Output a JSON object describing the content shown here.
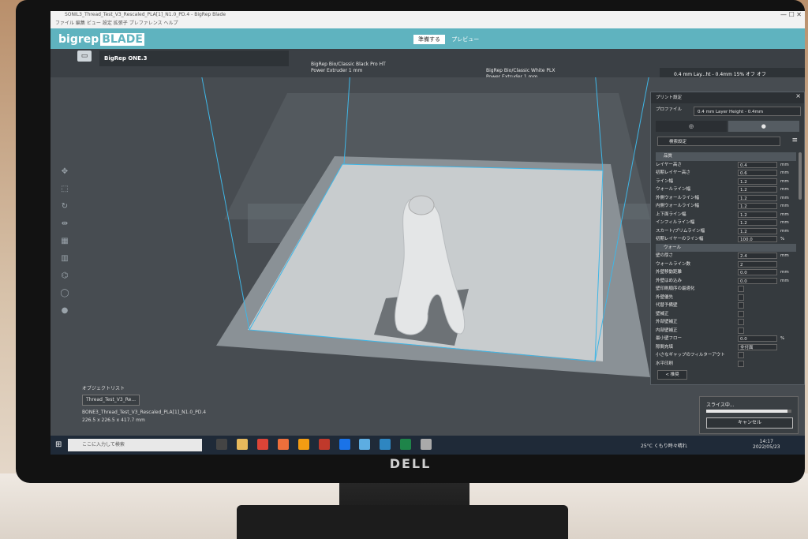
{
  "window": {
    "title": "SONIL3_Thread_Test_V3_Rescaled_PLA[1]_N1.0_PD.4 - BigRep Blade",
    "menu": [
      "ファイル",
      "編集",
      "ビュー",
      "設定",
      "拡張子",
      "プレファレンス",
      "ヘルプ"
    ],
    "controls": "— ☐ ✕"
  },
  "brand": {
    "logo": "bigrep",
    "logo_badge": "BLADE"
  },
  "stage_tabs": {
    "prepare": "準備する",
    "preview": "プレビュー"
  },
  "header": {
    "folder_icon": "folder-icon",
    "printer": "BigRep ONE.3",
    "extruder1": {
      "material": "BigRep Bio/Classic Black Pro HT",
      "extruder": "Power Extruder 1 mm"
    },
    "extruder2": {
      "material": "BigRep Bio/Classic White PLX",
      "extruder": "Power Extruder 1 mm"
    },
    "profile_summary": "0.4 mm Lay...ht - 0.4mm",
    "infill": "15%",
    "support": "オフ",
    "adhesion": "オフ"
  },
  "settings": {
    "title": "プリント設定",
    "profile_label": "プロファイル",
    "profile_value": "0.4 mm Layer Height - 0.4mm",
    "search_placeholder": "検索設定",
    "rows": [
      {
        "label": "品質",
        "type": "category"
      },
      {
        "label": "レイヤー高さ",
        "value": "0.4",
        "unit": "mm"
      },
      {
        "label": "初期レイヤー高さ",
        "value": "0.6",
        "unit": "mm"
      },
      {
        "label": "ライン幅",
        "value": "1.2",
        "unit": "mm"
      },
      {
        "label": "ウォールライン幅",
        "value": "1.2",
        "unit": "mm"
      },
      {
        "label": "外側ウォールライン幅",
        "value": "1.2",
        "unit": "mm"
      },
      {
        "label": "内側ウォールライン幅",
        "value": "1.2",
        "unit": "mm"
      },
      {
        "label": "上下面ライン幅",
        "value": "1.2",
        "unit": "mm"
      },
      {
        "label": "インフィルライン幅",
        "value": "1.2",
        "unit": "mm"
      },
      {
        "label": "スカート/ブリムライン幅",
        "value": "1.2",
        "unit": "mm"
      },
      {
        "label": "初期レイヤーのライン幅",
        "value": "100.0",
        "unit": "%"
      },
      {
        "label": "ウォール",
        "type": "category"
      },
      {
        "label": "壁の厚さ",
        "value": "2.4",
        "unit": "mm"
      },
      {
        "label": "ウォールライン数",
        "value": "2",
        "unit": ""
      },
      {
        "label": "外壁移動距離",
        "value": "0.0",
        "unit": "mm"
      },
      {
        "label": "外壁はめ込み",
        "value": "0.0",
        "unit": "mm"
      },
      {
        "label": "壁印刷順序の最適化",
        "type": "check"
      },
      {
        "label": "外壁優先",
        "type": "check"
      },
      {
        "label": "代替予備壁",
        "type": "check"
      },
      {
        "label": "壁補正",
        "type": "check"
      },
      {
        "label": "外部壁補正",
        "type": "check"
      },
      {
        "label": "内部壁補正",
        "type": "check"
      },
      {
        "label": "最小壁フロー",
        "value": "0.0",
        "unit": "%"
      },
      {
        "label": "隙間充填",
        "value": "全付面",
        "unit": ""
      },
      {
        "label": "小さなギャップのフィルターアウト",
        "type": "check"
      },
      {
        "label": "水平印刷",
        "type": "check"
      }
    ],
    "recommend_label": "< 推奨"
  },
  "objects": {
    "header": "オブジェクトリスト",
    "item": "Thread_Test_V3_Re...",
    "filename": "BONE3_Thread_Test_V3_Rescaled_PLA[1]_N1.0_PD.4",
    "dimensions": "226.5 x 226.5 x 417.7 mm"
  },
  "slice": {
    "label": "スライス中...",
    "cancel": "キャンセル",
    "progress": 0.95
  },
  "taskbar": {
    "search_placeholder": "ここに入力して検索",
    "weather": "25°C くもり時々晴れ",
    "time": "14:17",
    "date": "2022/05/23"
  }
}
